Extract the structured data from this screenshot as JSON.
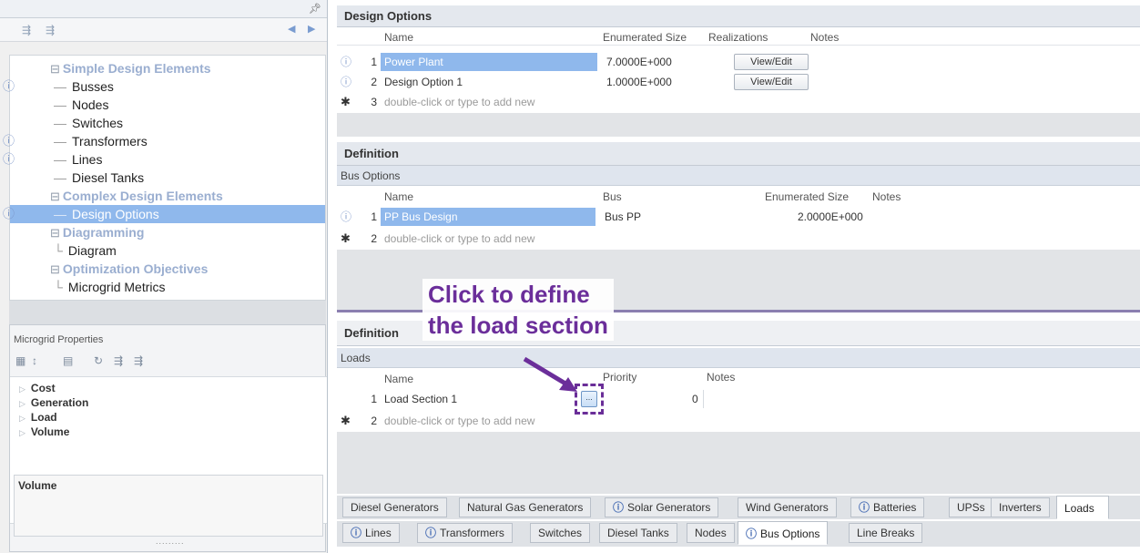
{
  "tree": {
    "categories": [
      {
        "label": "Simple Design Elements",
        "children": [
          "Busses",
          "Nodes",
          "Switches",
          "Transformers",
          "Lines",
          "Diesel Tanks"
        ]
      },
      {
        "label": "Complex Design Elements",
        "children": [
          "Design Options"
        ]
      },
      {
        "label": "Diagramming",
        "children": [
          "Diagram"
        ]
      },
      {
        "label": "Optimization Objectives",
        "children": [
          "Microgrid Metrics"
        ]
      }
    ],
    "selected": "Design Options"
  },
  "properties": {
    "title": "Microgrid Properties",
    "items": [
      "Cost",
      "Generation",
      "Load",
      "Volume"
    ],
    "description_title": "Volume",
    "grip": "........."
  },
  "design_options": {
    "header": "Design Options",
    "columns": [
      "Name",
      "Enumerated Size",
      "Realizations",
      "Notes"
    ],
    "rows": [
      {
        "num": "1",
        "name": "Power Plant",
        "size": "7.0000E+000",
        "button": "View/Edit"
      },
      {
        "num": "2",
        "name": "Design Option 1",
        "size": "1.0000E+000",
        "button": "View/Edit"
      }
    ],
    "new_row": {
      "num": "3",
      "placeholder": "double-click or type to add new"
    }
  },
  "bus_definition": {
    "header": "Definition",
    "sub_header": "Bus Options",
    "columns": [
      "Name",
      "Bus",
      "Enumerated Size",
      "Notes"
    ],
    "rows": [
      {
        "num": "1",
        "name": "PP Bus Design",
        "bus": "Bus PP",
        "size": "2.0000E+000"
      }
    ],
    "new_row": {
      "num": "2",
      "placeholder": "double-click or type to add new"
    }
  },
  "loads_definition": {
    "header": "Definition",
    "sub_header": "Loads",
    "columns": [
      "Name",
      "Priority",
      "Notes"
    ],
    "rows": [
      {
        "num": "1",
        "name": "Load Section 1",
        "priority": "0",
        "button": "..."
      }
    ],
    "new_row": {
      "num": "2",
      "placeholder": "double-click or type to add new"
    }
  },
  "callout": {
    "line1": "Click to define",
    "line2": "the load section",
    "color": "#6b2e9a"
  },
  "tabs_row1": [
    "Diesel Generators",
    "Natural Gas Generators",
    "Solar Generators",
    "Wind Generators",
    "Batteries",
    "UPSs",
    "Inverters",
    "Loads"
  ],
  "tabs_row2": [
    "Lines",
    "Transformers",
    "Switches",
    "Diesel Tanks",
    "Nodes",
    "Bus Options",
    "Line Breaks"
  ],
  "active_tabs": [
    "Loads",
    "Bus Options"
  ],
  "icons": {
    "info": "info-icon",
    "pin": "pin-icon"
  }
}
